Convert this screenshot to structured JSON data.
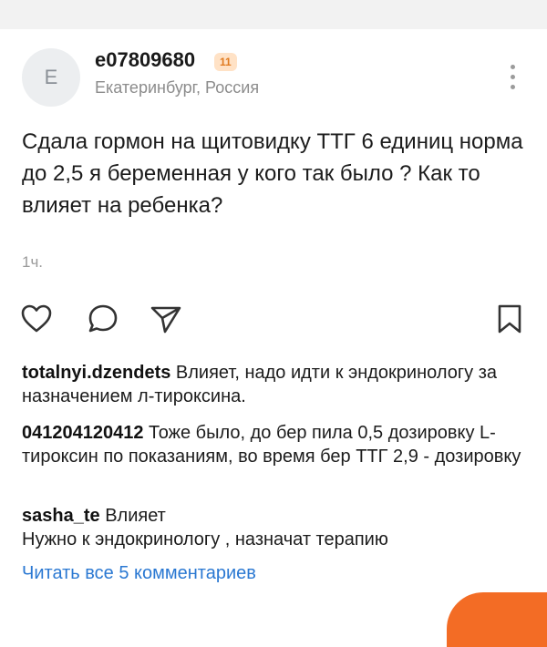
{
  "post": {
    "avatar_letter": "E",
    "username": "e07809680",
    "badge": "11",
    "location": "Екатеринбург, Россия",
    "text": "Сдала гормон на щитовидку ТТГ 6 единиц норма до 2,5 я беременная у кого так было ? Как то влияет на ребенка?",
    "time": "1ч."
  },
  "actions": {
    "icons": [
      "heart-icon",
      "comment-icon",
      "share-icon",
      "bookmark-icon"
    ]
  },
  "comments": [
    {
      "author": "totalnyi.dzendets",
      "text": "Влияет, надо идти к эндокринологу за назначением л-тироксина."
    },
    {
      "author": "041204120412",
      "text": "Тоже было, до бер пила 0,5 дозировку L-тироксин по показаниям, во время бер ТТГ 2,9 - дозировку"
    },
    {
      "author": "sasha_te",
      "text": "Влияет\nНужно к эндокринологу , назначат терапию"
    }
  ],
  "read_all_comments": "Читать все 5 комментариев",
  "colors": {
    "link": "#2a78d2",
    "badge_bg": "#ffe2c6",
    "badge_text": "#e07a1f",
    "accent": "#f36c25"
  }
}
